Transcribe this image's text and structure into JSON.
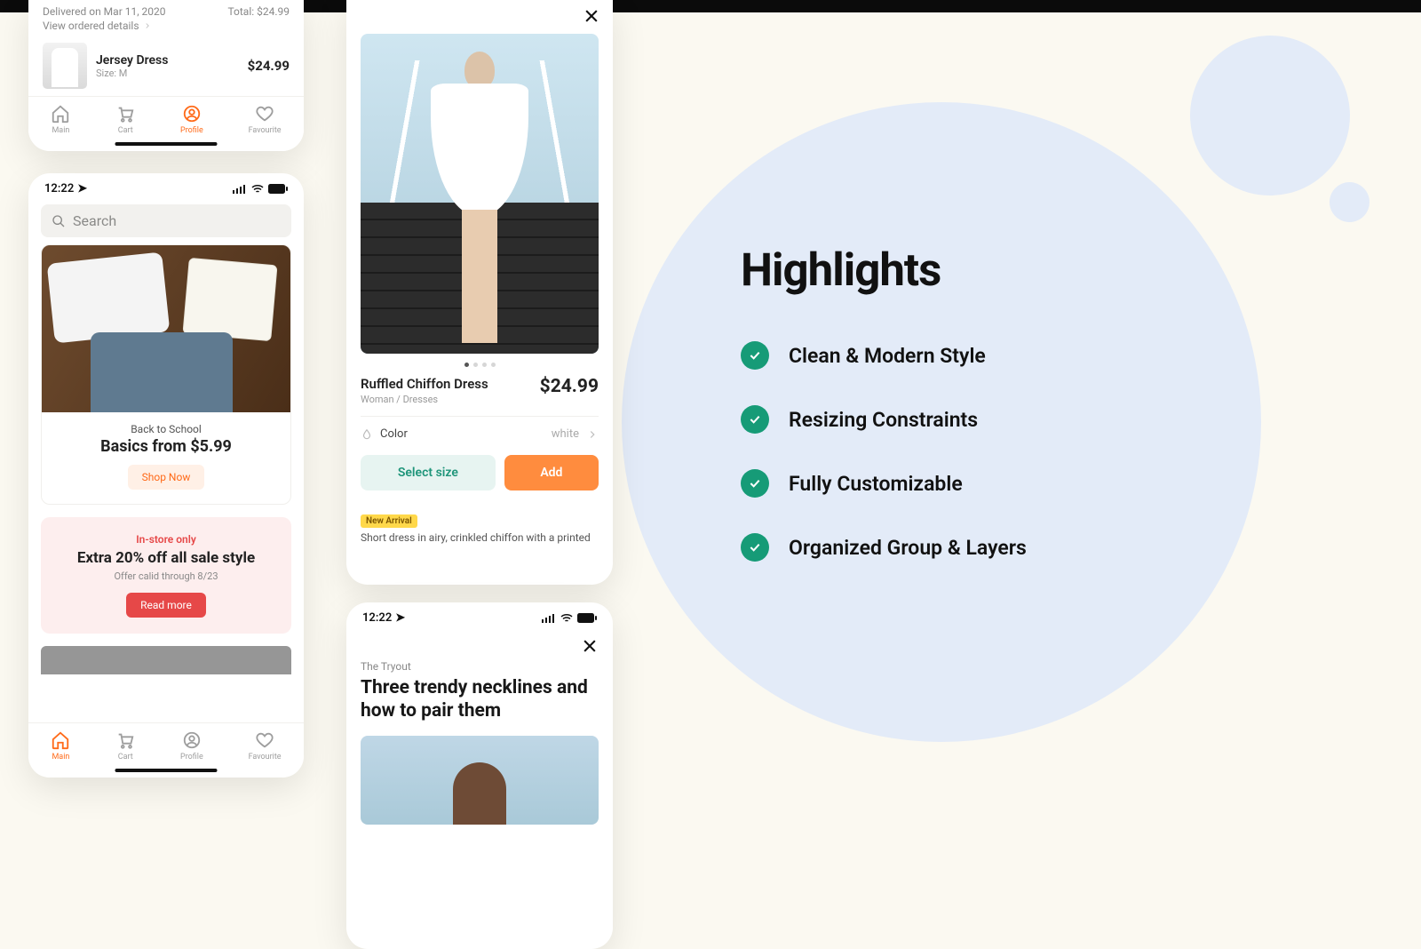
{
  "phone1": {
    "delivered": "Delivered on Mar 11, 2020",
    "total_label": "Total: $24.99",
    "view_details": "View ordered details",
    "order": {
      "name": "Jersey Dress",
      "size": "Size: M",
      "price": "$24.99"
    },
    "nav": {
      "main": "Main",
      "cart": "Cart",
      "profile": "Profile",
      "favourite": "Favourite"
    }
  },
  "phone2": {
    "time": "12:22",
    "search_placeholder": "Search",
    "promo": {
      "eyebrow": "Back to School",
      "title": "Basics from $5.99",
      "cta": "Shop Now"
    },
    "sale": {
      "eyebrow": "In-store only",
      "title": "Extra 20% off all sale style",
      "sub": "Offer calid through 8/23",
      "cta": "Read more"
    },
    "nav": {
      "main": "Main",
      "cart": "Cart",
      "profile": "Profile",
      "favourite": "Favourite"
    }
  },
  "phone3": {
    "product": {
      "name": "Ruffled Chiffon Dress",
      "category": "Woman / Dresses",
      "price": "$24.99"
    },
    "color_label": "Color",
    "color_value": "white",
    "select_btn": "Select size",
    "add_btn": "Add",
    "tag": "New Arrival",
    "desc": "Short dress in airy, crinkled chiffon with a printed"
  },
  "phone4": {
    "time": "12:22",
    "eyebrow": "The Tryout",
    "title": "Three trendy necklines and how to pair them"
  },
  "highlights": {
    "title": "Highlights",
    "items": [
      "Clean & Modern Style",
      "Resizing Constraints",
      "Fully Customizable",
      "Organized Group & Layers"
    ]
  }
}
